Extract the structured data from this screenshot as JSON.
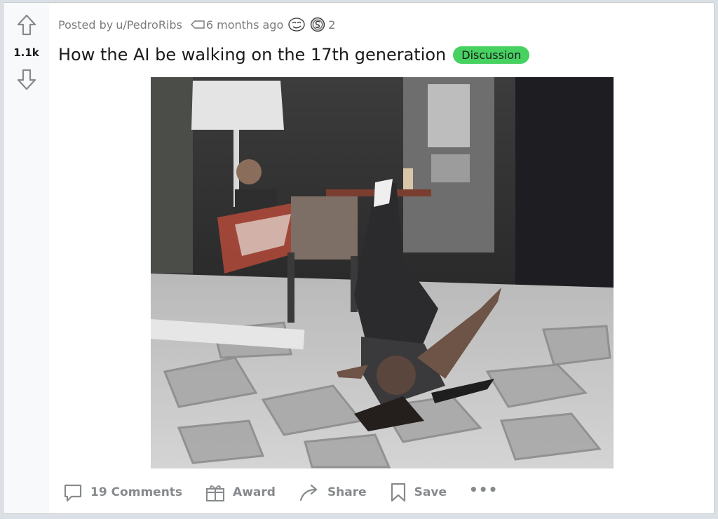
{
  "post": {
    "score": "1.1k",
    "meta": {
      "posted_by": "Posted by",
      "author": "u/PedroRibs",
      "time": "6 months ago",
      "award_count": "2"
    },
    "title": "How the AI be walking on the 17th generation",
    "flair": "Discussion",
    "media_icon": "video-thumbnail"
  },
  "actions": {
    "comments": "19 Comments",
    "award": "Award",
    "share": "Share",
    "save": "Save",
    "more": "•••"
  },
  "colors": {
    "flair_bg": "#46d160",
    "muted_text": "#878a8c",
    "vote_column_bg": "#f8f9fa"
  }
}
